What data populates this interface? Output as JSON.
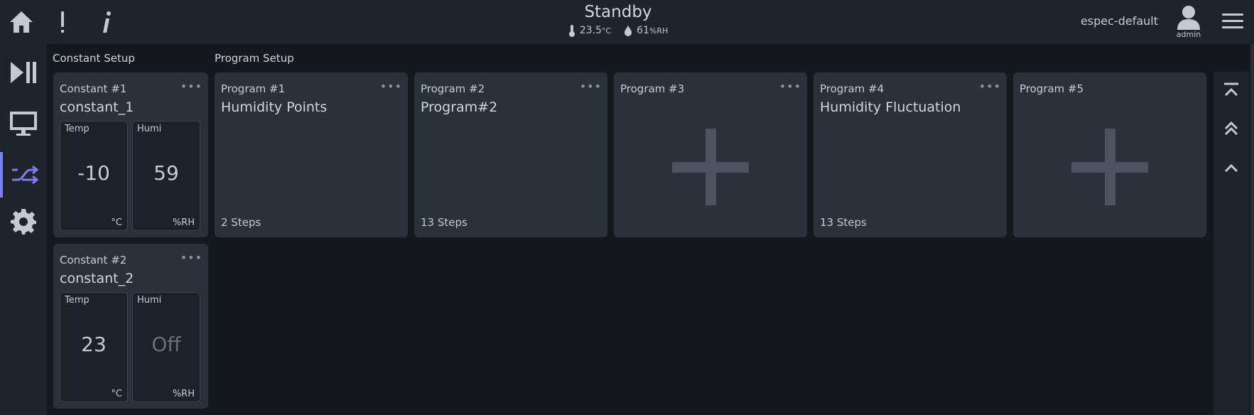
{
  "status": {
    "title": "Standby",
    "temp": "23.5",
    "temp_unit": "°C",
    "humi": "61",
    "humi_unit": "%RH"
  },
  "user": {
    "name": "espec-default",
    "role": "admin"
  },
  "sections": {
    "constant": "Constant Setup",
    "program": "Program Setup"
  },
  "constants": [
    {
      "kicker": "Constant #1",
      "name": "constant_1",
      "temp_label": "Temp",
      "temp_value": "-10",
      "temp_unit": "°C",
      "humi_label": "Humi",
      "humi_value": "59",
      "humi_unit": "%RH"
    },
    {
      "kicker": "Constant #2",
      "name": "constant_2",
      "temp_label": "Temp",
      "temp_value": "23",
      "temp_unit": "°C",
      "humi_label": "Humi",
      "humi_value": "Off",
      "humi_unit": "%RH"
    }
  ],
  "programs": [
    {
      "kicker": "Program #1",
      "name": "Humidity Points",
      "steps": "2 Steps"
    },
    {
      "kicker": "Program #2",
      "name": "Program#2",
      "steps": "13 Steps"
    },
    {
      "kicker": "Program #3",
      "name": "",
      "steps": ""
    },
    {
      "kicker": "Program #4",
      "name": "Humidity Fluctuation",
      "steps": "13 Steps"
    },
    {
      "kicker": "Program #5",
      "name": "",
      "steps": ""
    }
  ],
  "menu_dots": "•••",
  "icons": {
    "home": "home-icon",
    "alert": "alert-icon",
    "info": "info-icon",
    "play_pause": "play-pause-icon",
    "monitor": "monitor-icon",
    "program": "shuffle-icon",
    "settings": "gear-icon",
    "user": "user-icon",
    "menu": "hamburger-icon",
    "scroll_top": "scroll-to-top-icon",
    "page_up": "double-chevron-up-icon",
    "up": "chevron-up-icon"
  },
  "colors": {
    "accent": "#7b7ff0",
    "card": "#2b313a",
    "panel": "#1f242b",
    "background": "#15181d"
  }
}
